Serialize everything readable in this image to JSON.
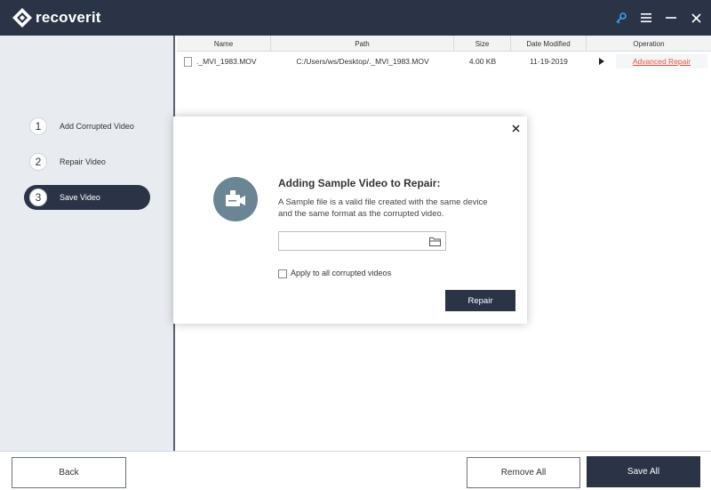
{
  "app": {
    "title": "recoverit"
  },
  "titlebar": {
    "icons": [
      "key-icon",
      "menu-icon",
      "minimize-icon",
      "close-icon"
    ]
  },
  "sidebar": {
    "steps": [
      {
        "number": "1",
        "label": "Add Corrupted Video"
      },
      {
        "number": "2",
        "label": "Repair Video"
      },
      {
        "number": "3",
        "label": "Save Video",
        "active": true
      }
    ]
  },
  "table": {
    "headers": {
      "name": "Name",
      "path": "Path",
      "size": "Size",
      "date": "Date Modified",
      "operation": "Operation"
    },
    "rows": [
      {
        "name": "._MVI_1983.MOV",
        "path": "C:/Users/ws/Desktop/._MVI_1983.MOV",
        "size": "4.00  KB",
        "date": "11-19-2019",
        "operation": "Advanced Repair"
      }
    ]
  },
  "dialog": {
    "title": "Adding Sample Video to Repair:",
    "description": "A Sample file is a valid file created with the same device and the same format as the corrupted video.",
    "input_value": "",
    "checkbox_label": "Apply to all corrupted videos",
    "checkbox_checked": false,
    "repair_label": "Repair"
  },
  "footer": {
    "back": "Back",
    "remove_all": "Remove All",
    "save_all": "Save All"
  },
  "colors": {
    "dark": "#2b3447",
    "link": "#e5533d",
    "sidebar_bg": "#e8ebef"
  }
}
